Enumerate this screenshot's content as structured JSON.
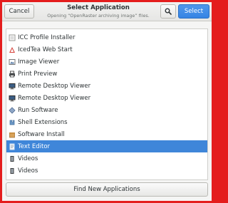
{
  "header": {
    "cancel_label": "Cancel",
    "title": "Select Application",
    "subtitle": "Opening “OpenRaster archiving image” files.",
    "select_label": "Select"
  },
  "apps": [
    {
      "label": "ICC Profile Installer",
      "icon": "icc-profile-icon"
    },
    {
      "label": "IcedTea Web Start",
      "icon": "icedtea-icon"
    },
    {
      "label": "Image Viewer",
      "icon": "image-viewer-icon"
    },
    {
      "label": "Print Preview",
      "icon": "print-preview-icon"
    },
    {
      "label": "Remote Desktop Viewer",
      "icon": "remote-desktop-icon"
    },
    {
      "label": "Remote Desktop Viewer",
      "icon": "remote-desktop-icon"
    },
    {
      "label": "Run Software",
      "icon": "run-software-icon"
    },
    {
      "label": "Shell Extensions",
      "icon": "shell-extensions-icon"
    },
    {
      "label": "Software Install",
      "icon": "software-install-icon"
    },
    {
      "label": "Text Editor",
      "icon": "text-editor-icon",
      "selected": true
    },
    {
      "label": "Videos",
      "icon": "videos-icon"
    },
    {
      "label": "Videos",
      "icon": "videos-icon"
    }
  ],
  "footer": {
    "find_label": "Find New Applications"
  },
  "colors": {
    "accent": "#3584e4",
    "selection": "#3f86d9",
    "frame": "#e41d1d"
  }
}
